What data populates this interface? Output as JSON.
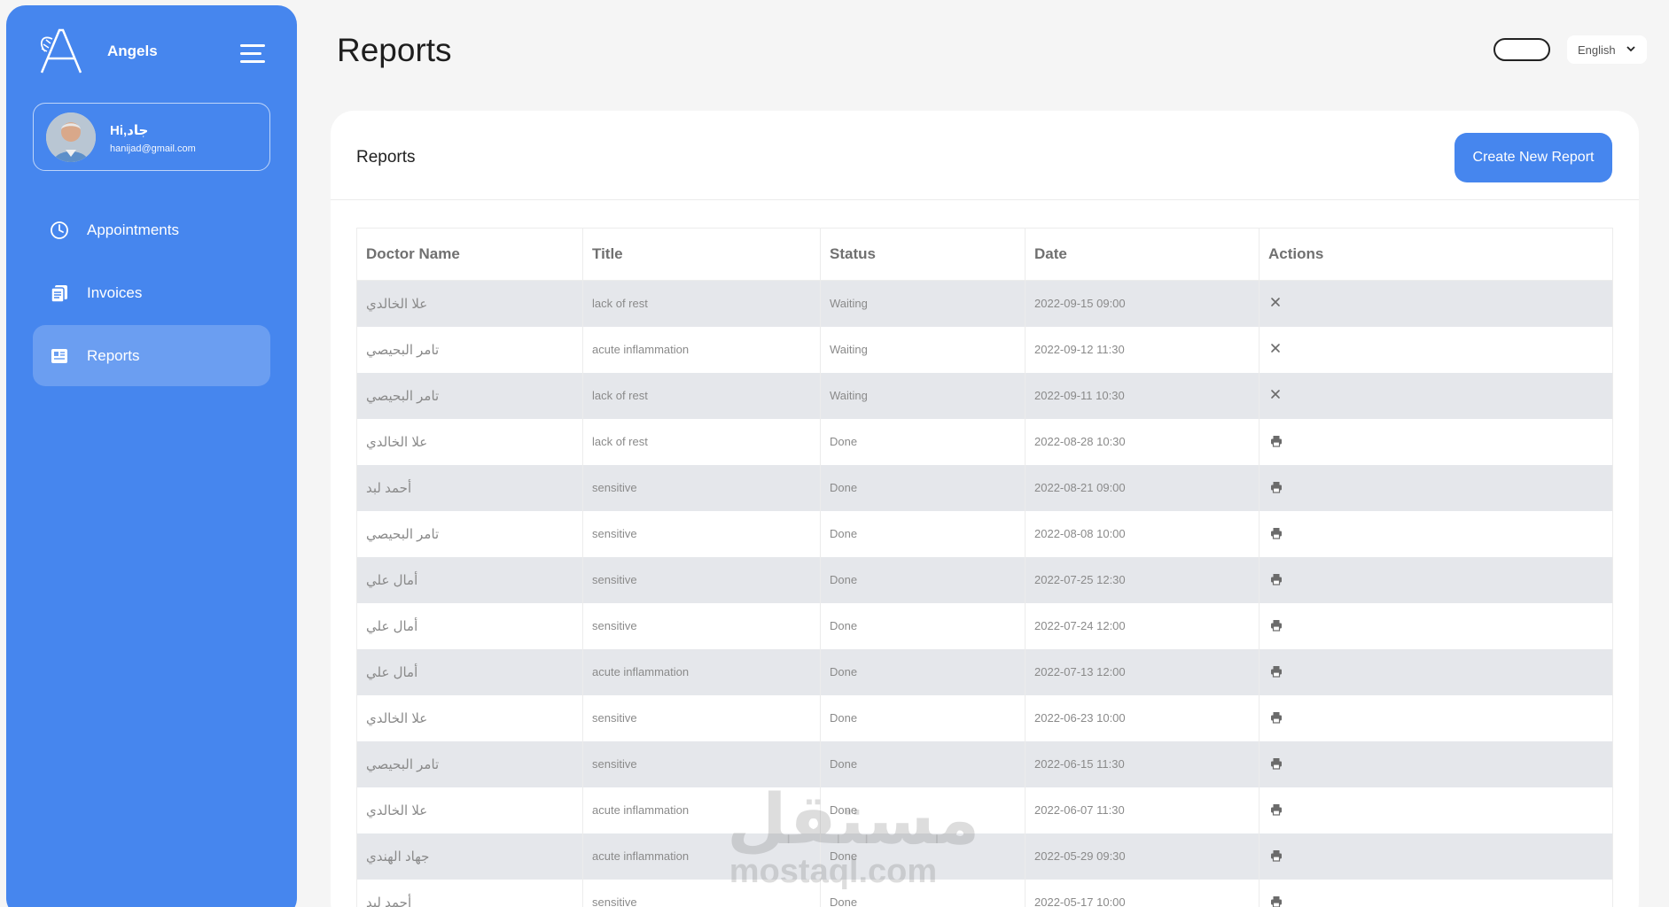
{
  "sidebar": {
    "brand": "Angels",
    "user": {
      "greeting": "Hi,جاد",
      "email": "hanijad@gmail.com"
    },
    "items": [
      {
        "label": "Appointments",
        "icon": "clock-icon",
        "active": false
      },
      {
        "label": "Invoices",
        "icon": "invoices-icon",
        "active": false
      },
      {
        "label": "Reports",
        "icon": "reports-icon",
        "active": true
      }
    ]
  },
  "header": {
    "title": "Reports",
    "language": "English"
  },
  "card": {
    "title": "Reports",
    "create_button": "Create New Report"
  },
  "table": {
    "columns": [
      "Doctor Name",
      "Title",
      "Status",
      "Date",
      "Actions"
    ],
    "rows": [
      {
        "doctor": "علا الخالدي",
        "title": "lack of rest",
        "status": "Waiting",
        "date": "2022-09-15 09:00",
        "action": "cancel"
      },
      {
        "doctor": "تامر البحيصي",
        "title": "acute inflammation",
        "status": "Waiting",
        "date": "2022-09-12 11:30",
        "action": "cancel"
      },
      {
        "doctor": "تامر البحيصي",
        "title": "lack of rest",
        "status": "Waiting",
        "date": "2022-09-11 10:30",
        "action": "cancel"
      },
      {
        "doctor": "علا الخالدي",
        "title": "lack of rest",
        "status": "Done",
        "date": "2022-08-28 10:30",
        "action": "print"
      },
      {
        "doctor": "أحمد لبد",
        "title": "sensitive",
        "status": "Done",
        "date": "2022-08-21 09:00",
        "action": "print"
      },
      {
        "doctor": "تامر البحيصي",
        "title": "sensitive",
        "status": "Done",
        "date": "2022-08-08 10:00",
        "action": "print"
      },
      {
        "doctor": "أمال علي",
        "title": "sensitive",
        "status": "Done",
        "date": "2022-07-25 12:30",
        "action": "print"
      },
      {
        "doctor": "أمال علي",
        "title": "sensitive",
        "status": "Done",
        "date": "2022-07-24 12:00",
        "action": "print"
      },
      {
        "doctor": "أمال علي",
        "title": "acute inflammation",
        "status": "Done",
        "date": "2022-07-13 12:00",
        "action": "print"
      },
      {
        "doctor": "علا الخالدي",
        "title": "sensitive",
        "status": "Done",
        "date": "2022-06-23 10:00",
        "action": "print"
      },
      {
        "doctor": "تامر البحيصي",
        "title": "sensitive",
        "status": "Done",
        "date": "2022-06-15 11:30",
        "action": "print"
      },
      {
        "doctor": "علا الخالدي",
        "title": "acute inflammation",
        "status": "Done",
        "date": "2022-06-07 11:30",
        "action": "print"
      },
      {
        "doctor": "جهاد الهندي",
        "title": "acute inflammation",
        "status": "Done",
        "date": "2022-05-29 09:30",
        "action": "print"
      },
      {
        "doctor": "أحمد لبد",
        "title": "sensitive",
        "status": "Done",
        "date": "2022-05-17 10:00",
        "action": "print"
      }
    ]
  },
  "watermark": {
    "arabic": "مستقل",
    "latin": "mostaql.com"
  },
  "colors": {
    "primary": "#4686ee",
    "row_alt": "#e5e7eb",
    "background": "#f5f5f5"
  }
}
